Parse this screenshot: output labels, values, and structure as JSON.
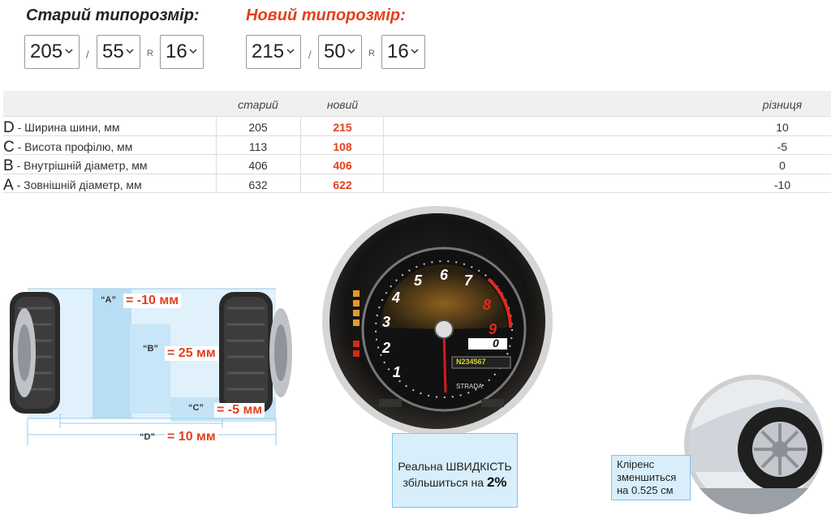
{
  "old_size": {
    "title": "Старий типорозмір:",
    "width": "205",
    "profile": "55",
    "r": "R",
    "diameter": "16",
    "slash": "/"
  },
  "new_size": {
    "title": "Новий типорозмір:",
    "width": "215",
    "profile": "50",
    "r": "R",
    "diameter": "16",
    "slash": "/"
  },
  "table": {
    "headers": {
      "old": "старий",
      "new": "новий",
      "diff": "різниця"
    },
    "rows": [
      {
        "letter": "D",
        "label": " - Ширина шини, мм",
        "old": "205",
        "new": "215",
        "diff": "10"
      },
      {
        "letter": "C",
        "label": " - Висота профілю, мм",
        "old": "113",
        "new": "108",
        "diff": "-5"
      },
      {
        "letter": "B",
        "label": " - Внутрішній діаметр, мм",
        "old": "406",
        "new": "406",
        "diff": "0"
      },
      {
        "letter": "A",
        "label": " - Зовнішній діаметр, мм",
        "old": "632",
        "new": "622",
        "diff": "-10"
      }
    ]
  },
  "diagram": {
    "a_label": "“A”",
    "a_value": "= -10 мм",
    "b_label": "“B”",
    "b_value": "= 25 мм",
    "c_label": "“C”",
    "c_value": "= -5 мм",
    "d_label": "“D”",
    "d_value": "= 10 мм"
  },
  "speedo": {
    "note_line1": "Реальна ШВИДКІСТЬ",
    "note_line2": "збільшиться на",
    "note_pct": "2%",
    "dial": [
      "1",
      "2",
      "3",
      "4",
      "5",
      "6",
      "7",
      "8",
      "9"
    ],
    "gear": "0",
    "odo": "N234567",
    "mode": "STRADA"
  },
  "clearance": {
    "line1": "Кліренс",
    "line2": "зменшиться",
    "line3": "на 0.525 см"
  },
  "colors": {
    "accent": "#e2401c",
    "highlight": "#d8eefb",
    "highlight_border": "#7ac6ec"
  }
}
